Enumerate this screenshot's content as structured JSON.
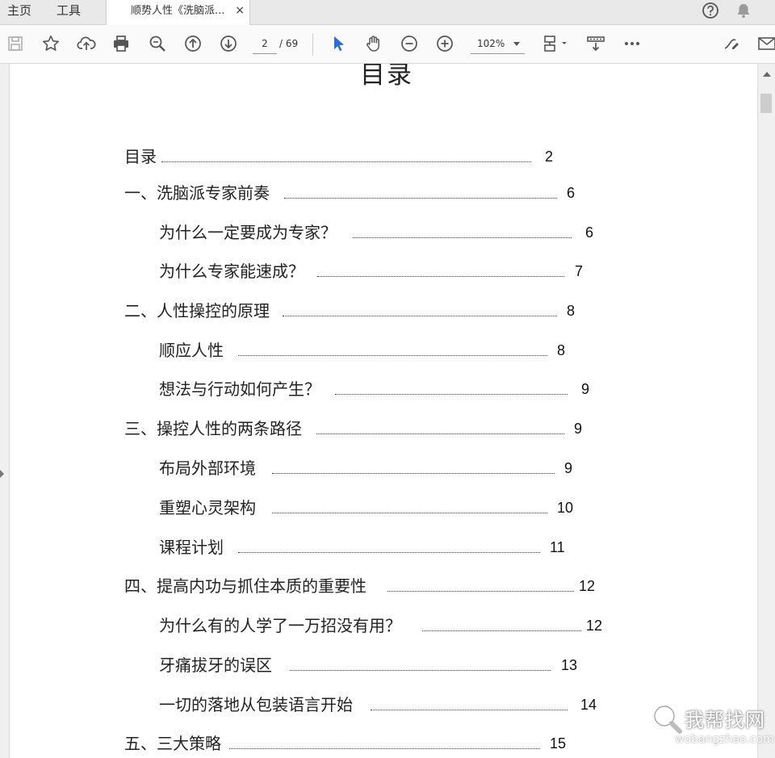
{
  "tabs": {
    "home": "主页",
    "tools": "工具",
    "document_title": "顺势人性《洗脑派...",
    "close": "×"
  },
  "toolbar": {
    "current_page": "2",
    "total_pages": "/ 69",
    "zoom": "102%"
  },
  "document": {
    "heading": "目录",
    "toc": [
      {
        "title": "目录",
        "page": "2",
        "level": 1
      },
      {
        "title": "一、洗脑派专家前奏",
        "page": "6",
        "level": 1
      },
      {
        "title": "为什么一定要成为专家？",
        "page": "6",
        "level": 2
      },
      {
        "title": "为什么专家能速成？",
        "page": "7",
        "level": 2
      },
      {
        "title": "二、人性操控的原理",
        "page": "8",
        "level": 1
      },
      {
        "title": "顺应人性",
        "page": "8",
        "level": 2
      },
      {
        "title": "想法与行动如何产生？",
        "page": "9",
        "level": 2
      },
      {
        "title": "三、操控人性的两条路径",
        "page": "9",
        "level": 1
      },
      {
        "title": "布局外部环境",
        "page": "9",
        "level": 2
      },
      {
        "title": "重塑心灵架构",
        "page": "10",
        "level": 2
      },
      {
        "title": "课程计划",
        "page": "11",
        "level": 2
      },
      {
        "title": "四、提高内功与抓住本质的重要性",
        "page": "12",
        "level": 1
      },
      {
        "title": "为什么有的人学了一万招没有用？",
        "page": "12",
        "level": 2
      },
      {
        "title": "牙痛拔牙的误区",
        "page": "13",
        "level": 2
      },
      {
        "title": "一切的落地从包装语言开始",
        "page": "14",
        "level": 2
      },
      {
        "title": "五、三大策略",
        "page": "15",
        "level": 1
      }
    ]
  },
  "watermark": {
    "name": "我帮找网",
    "url": "wobangzhao.com"
  },
  "icons": {
    "help": "help-icon",
    "notifications": "bell-icon",
    "save": "save-icon",
    "bookmark": "star-icon",
    "upload": "cloud-upload-icon",
    "print": "print-icon",
    "find": "zoom-search-icon",
    "prev_page": "arrow-up-circle-icon",
    "next_page": "arrow-down-circle-icon",
    "select": "pointer-icon",
    "pan": "hand-icon",
    "zoom_out": "zoom-out-icon",
    "zoom_in": "zoom-in-icon",
    "page_layout": "page-layout-icon",
    "scroll_mode": "scroll-mode-icon",
    "more": "more-icon",
    "sign": "sign-icon",
    "email": "email-icon"
  }
}
